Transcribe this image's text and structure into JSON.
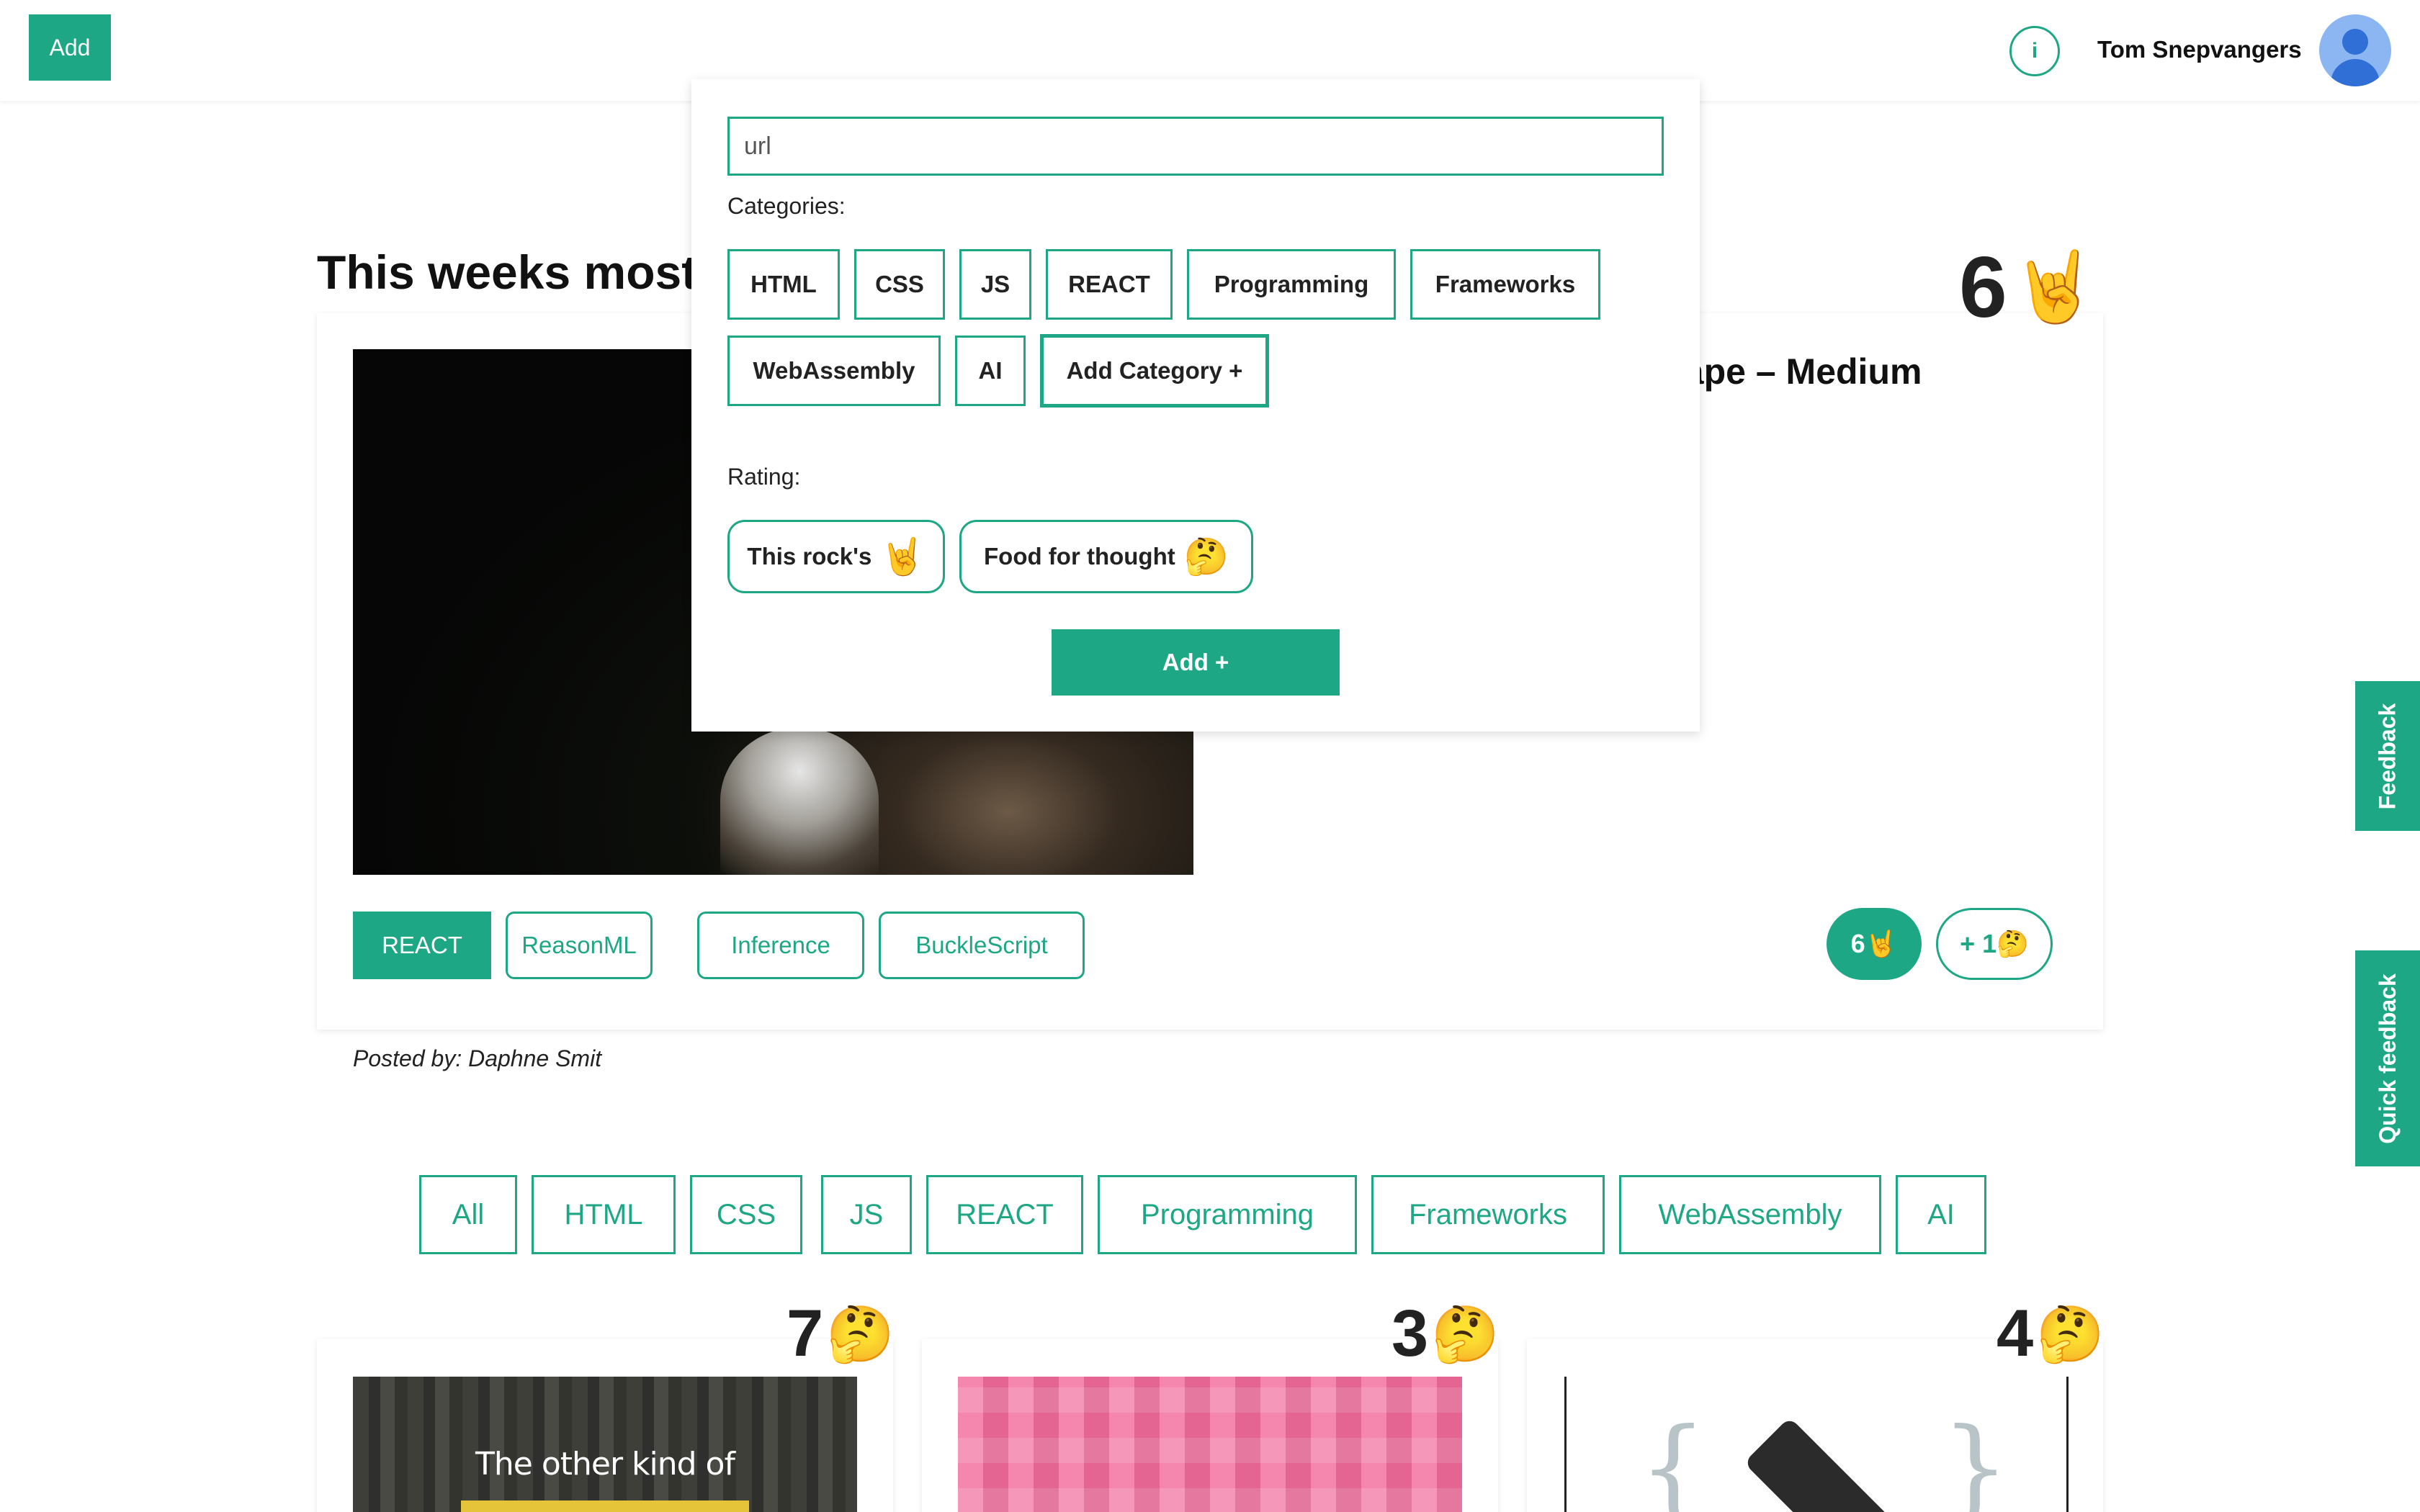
{
  "header": {
    "add_label": "Add",
    "info_label": "i",
    "user_name": "Tom Snepvangers"
  },
  "featured": {
    "title": "This weeks most",
    "headline": "cape – Medium",
    "count": "6",
    "count_emoji": "🤘",
    "tags": [
      "REACT",
      "ReasonML",
      "Inference",
      "BuckleScript"
    ],
    "rating_rock": "6🤘",
    "rating_thought": "+ 1🤔",
    "posted_by": "Posted by: Daphne Smit"
  },
  "filters": [
    "All",
    "HTML",
    "CSS",
    "JS",
    "REACT",
    "Programming",
    "Frameworks",
    "WebAssembly",
    "AI"
  ],
  "cards": [
    {
      "count": "7",
      "emoji": "🤔",
      "thumb_text": "The other kind of"
    },
    {
      "count": "3",
      "emoji": "🤔"
    },
    {
      "count": "4",
      "emoji": "🤔"
    }
  ],
  "side_tabs": {
    "feedback": "Feedback",
    "quick_feedback": "Quick feedback"
  },
  "popover": {
    "url_placeholder": "url",
    "categories_label": "Categories:",
    "categories": [
      "HTML",
      "CSS",
      "JS",
      "REACT",
      "Programming",
      "Frameworks",
      "WebAssembly",
      "AI"
    ],
    "add_category_label": "Add Category +",
    "rating_label": "Rating:",
    "rating_options": [
      {
        "label": "This rock's",
        "emoji": "🤘"
      },
      {
        "label": "Food for thought",
        "emoji": "🤔"
      }
    ],
    "submit_label": "Add +"
  },
  "colors": {
    "accent": "#1ea784",
    "text": "#111111",
    "background": "#ffffff"
  }
}
